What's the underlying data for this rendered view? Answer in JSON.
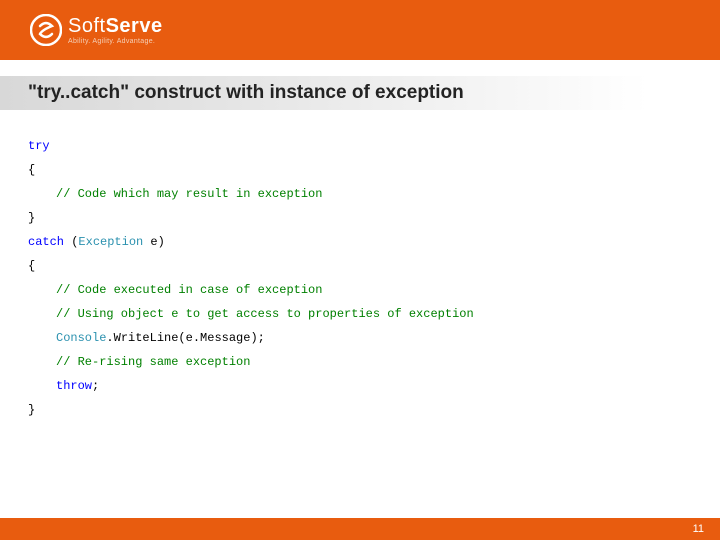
{
  "header": {
    "logo_main_light": "Soft",
    "logo_main_bold": "Serve",
    "logo_tagline": "Ability. Agility. Advantage."
  },
  "title": "\"try..catch\" construct with instance of exception",
  "code": {
    "l1_try": "try",
    "l2_brace": "{",
    "l3_cmt": "// Code which may result in exception",
    "l4_brace": "}",
    "l5_catch": "catch",
    "l5_paren_open": " (",
    "l5_type": "Exception",
    "l5_rest": " e)",
    "l6_brace": "{",
    "l7_cmt": "// Code executed in case of exception",
    "l8_cmt": "// Using object e to get access to properties of exception",
    "l9_console": "Console",
    "l9_rest": ".WriteLine(e.Message);",
    "l10_cmt": "// Re-rising same exception",
    "l11_throw": "throw",
    "l11_semi": ";",
    "l12_brace": "}"
  },
  "footer": {
    "page_number": "11"
  }
}
